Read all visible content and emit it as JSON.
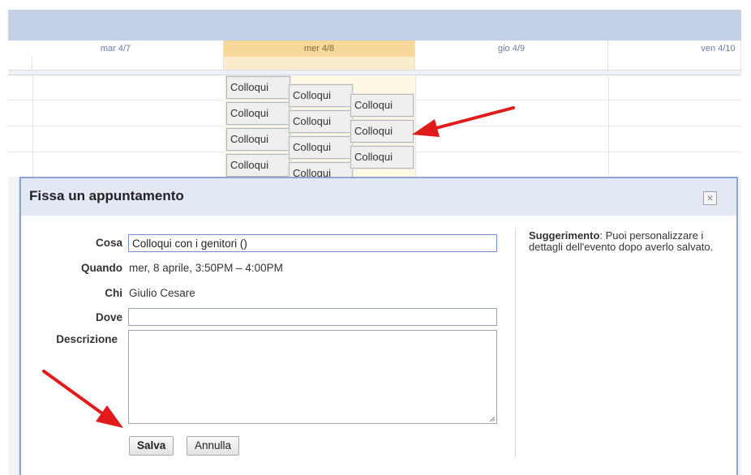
{
  "calendar": {
    "days": [
      {
        "label": "mar 4/7",
        "today": false
      },
      {
        "label": "mer 4/8",
        "today": true
      },
      {
        "label": "gio 4/9",
        "today": false
      },
      {
        "label": "ven 4/10",
        "today": false
      }
    ],
    "events": [
      {
        "label": "Colloqui"
      },
      {
        "label": "Colloqui"
      },
      {
        "label": "Colloqui"
      },
      {
        "label": "Colloqui"
      },
      {
        "label": "Colloqui"
      },
      {
        "label": "Colloqui"
      },
      {
        "label": "Colloqui"
      },
      {
        "label": "Colloqui"
      },
      {
        "label": "Colloqui"
      },
      {
        "label": "Colloqui"
      },
      {
        "label": "Colloqui"
      }
    ]
  },
  "dialog": {
    "title": "Fissa un appuntamento",
    "close_icon": "close-icon",
    "fields": {
      "cosa_label": "Cosa",
      "cosa_value": "Colloqui con i genitori ()",
      "quando_label": "Quando",
      "quando_value": "mer, 8 aprile, 3:50PM – 4:00PM",
      "chi_label": "Chi",
      "chi_value": "Giulio Cesare",
      "dove_label": "Dove",
      "dove_value": "",
      "descrizione_label": "Descrizione",
      "descrizione_value": ""
    },
    "buttons": {
      "save": "Salva",
      "cancel": "Annulla"
    },
    "tip": {
      "heading": "Suggerimento",
      "text": ": Puoi personalizzare i dettagli dell'evento dopo averlo salvato."
    }
  },
  "annotations": {
    "arrow_color": "#e01b1b"
  }
}
